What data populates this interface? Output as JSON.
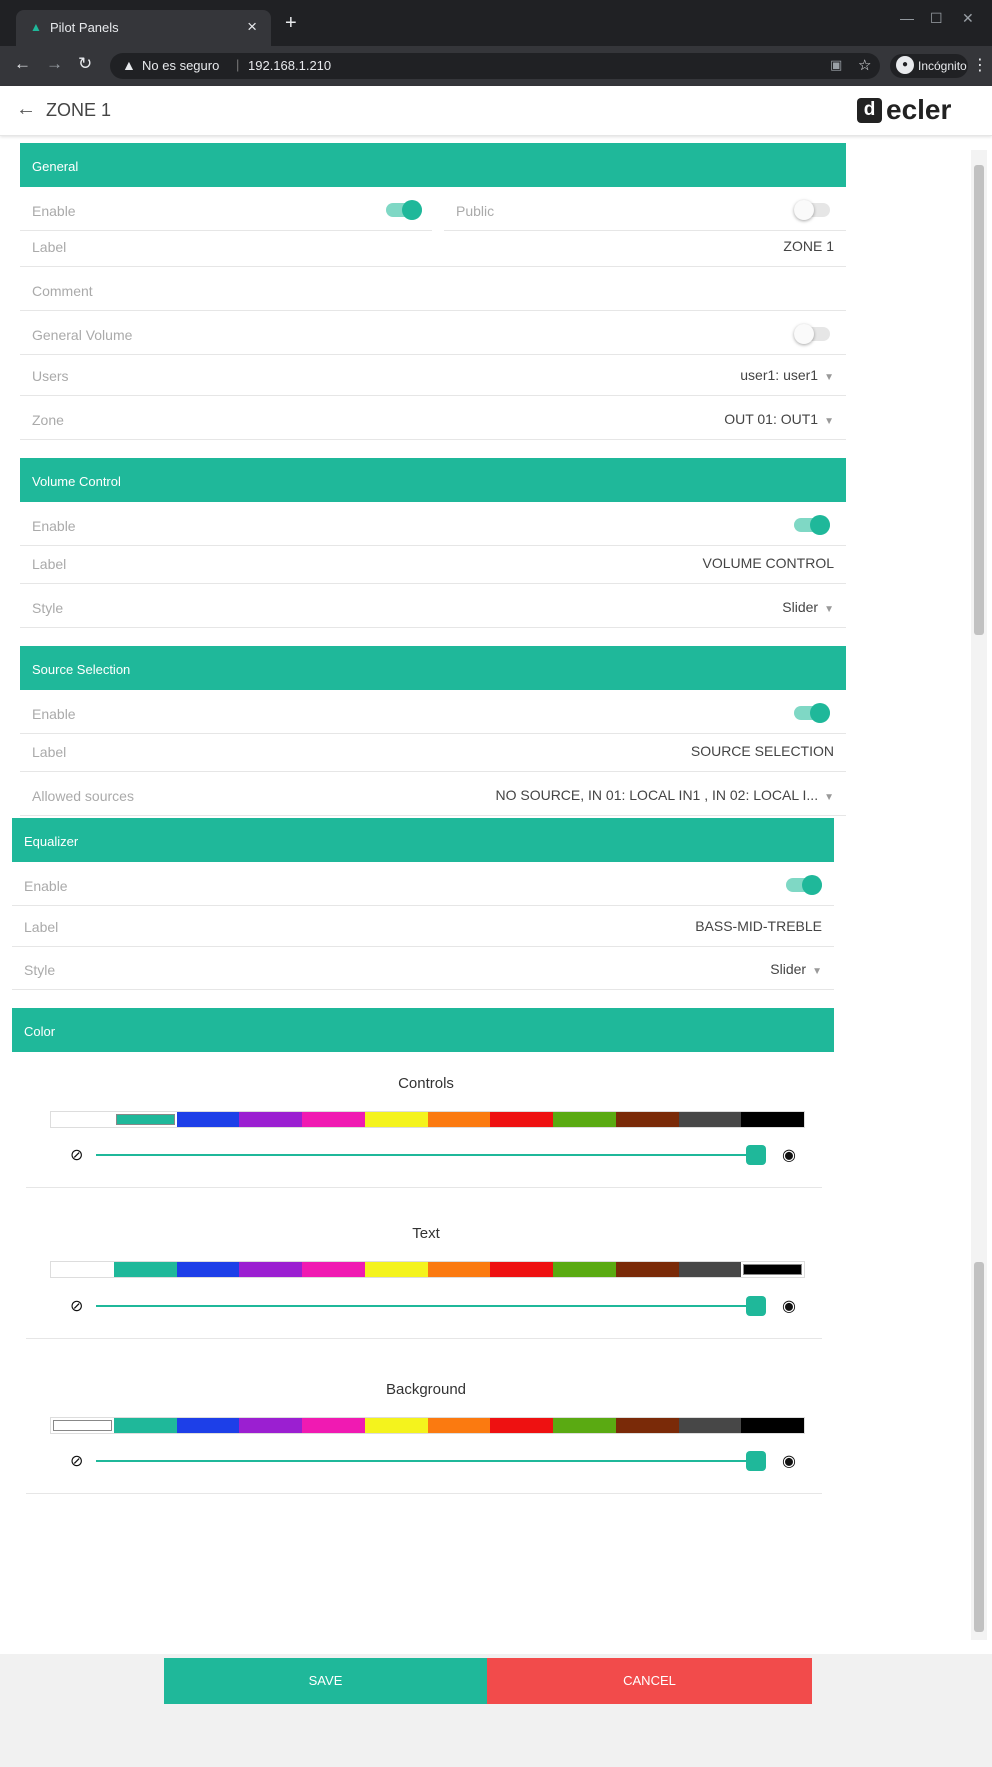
{
  "browser": {
    "tab_title": "Pilot Panels",
    "security_label": "No es seguro",
    "url": "192.168.1.210",
    "incognito_label": "Incógnito"
  },
  "header": {
    "title": "ZONE 1",
    "logo_text": "ecler"
  },
  "general": {
    "title": "General",
    "enable_label": "Enable",
    "public_label": "Public",
    "label_label": "Label",
    "label_value": "ZONE 1",
    "comment_label": "Comment",
    "general_volume_label": "General Volume",
    "users_label": "Users",
    "users_value": "user1: user1",
    "zone_label": "Zone",
    "zone_value": "OUT 01: OUT1"
  },
  "volume_control": {
    "title": "Volume Control",
    "enable_label": "Enable",
    "label_label": "Label",
    "label_value": "VOLUME CONTROL",
    "style_label": "Style",
    "style_value": "Slider"
  },
  "source_selection": {
    "title": "Source Selection",
    "enable_label": "Enable",
    "label_label": "Label",
    "label_value": "SOURCE SELECTION",
    "allowed_label": "Allowed sources",
    "allowed_value": "NO SOURCE, IN 01: LOCAL IN1 , IN 02: LOCAL I..."
  },
  "equalizer": {
    "title": "Equalizer",
    "enable_label": "Enable",
    "label_label": "Label",
    "label_value": "BASS-MID-TREBLE",
    "style_label": "Style",
    "style_value": "Slider"
  },
  "color": {
    "title": "Color",
    "palette": [
      "#ffffff",
      "#1fb89a",
      "#1d3fe8",
      "#9b1fd1",
      "#f01ab2",
      "#f4f31d",
      "#fb7a10",
      "#ee1111",
      "#5aaa12",
      "#7a2a08",
      "#474747",
      "#000000"
    ],
    "panels": [
      {
        "title": "Controls",
        "selected_index": 1,
        "opacity": 1.0
      },
      {
        "title": "Text",
        "selected_index": 11,
        "opacity": 1.0
      },
      {
        "title": "Background",
        "selected_index": 0,
        "opacity": 1.0
      }
    ]
  },
  "footer": {
    "save_label": "SAVE",
    "cancel_label": "CANCEL"
  },
  "toggles": {
    "general_enable": true,
    "general_public": false,
    "general_volume": false,
    "volume_enable": true,
    "source_enable": true,
    "eq_enable": true
  },
  "colors": {
    "accent": "#1fb89a",
    "cancel": "#f24b4b"
  }
}
